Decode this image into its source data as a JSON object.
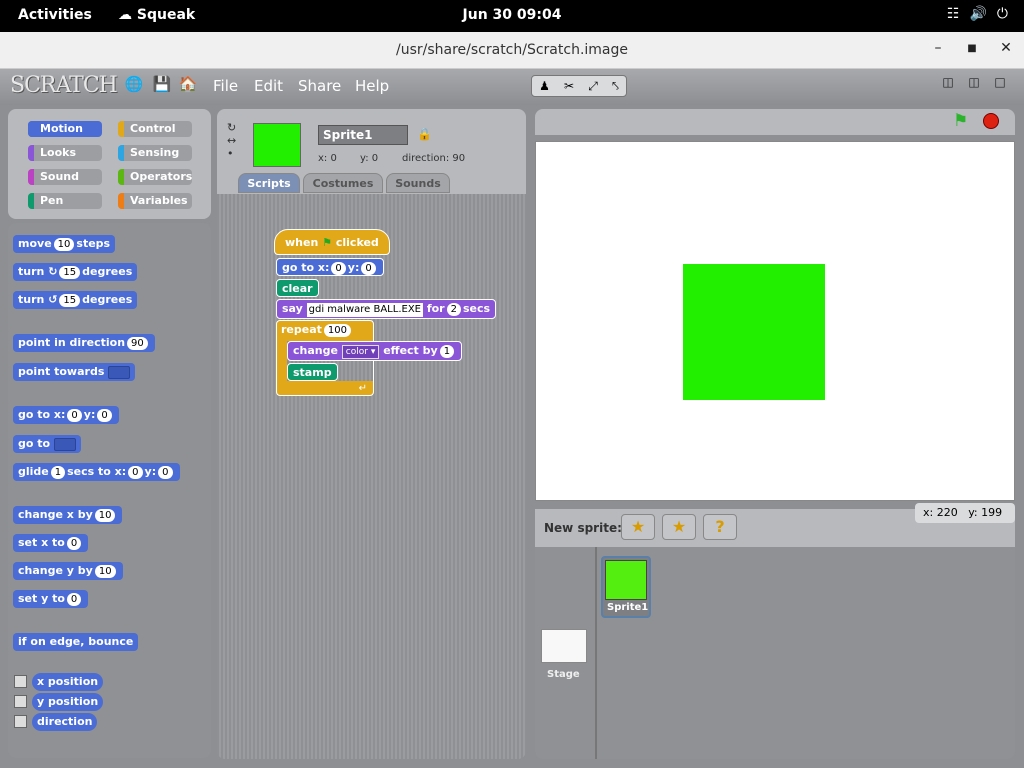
{
  "system": {
    "activities": "Activities",
    "app_name": "Squeak",
    "clock": "Jun 30  09:04"
  },
  "window": {
    "title": "/usr/share/scratch/Scratch.image"
  },
  "menu": {
    "logo": "SCRATCH",
    "file": "File",
    "edit": "Edit",
    "share": "Share",
    "help": "Help"
  },
  "categories": [
    "Motion",
    "Control",
    "Looks",
    "Sensing",
    "Sound",
    "Operators",
    "Pen",
    "Variables"
  ],
  "category_colors": {
    "motion": "#4a6cd4",
    "control": "#e1a91a",
    "looks": "#8a55d7",
    "sensing": "#2ca5e2",
    "sound": "#bb42c3",
    "operators": "#5cb712",
    "pen": "#0e9a6c",
    "variables": "#ee7d16"
  },
  "palette": {
    "move": "move",
    "move_val": "10",
    "move_unit": "steps",
    "turn": "turn",
    "turn_val": "15",
    "degrees": "degrees",
    "point_dir": "point in direction",
    "point_dir_val": "90",
    "point_towards": "point towards",
    "goto_xy": "go to x:",
    "goto_x": "0",
    "y_label": "y:",
    "goto_y": "0",
    "goto": "go to",
    "glide": "glide",
    "glide_secs": "1",
    "glide_mid": "secs to x:",
    "glide_x": "0",
    "glide_y": "0",
    "change_x": "change x by",
    "change_x_val": "10",
    "set_x": "set x to",
    "set_x_val": "0",
    "change_y": "change y by",
    "change_y_val": "10",
    "set_y": "set y to",
    "set_y_val": "0",
    "bounce": "if on edge, bounce",
    "x_position": "x position",
    "y_position": "y position",
    "direction": "direction"
  },
  "sprite": {
    "name": "Sprite1",
    "x_label": "x: 0",
    "y_label": "y: 0",
    "direction": "direction: 90"
  },
  "tabs": [
    "Scripts",
    "Costumes",
    "Sounds"
  ],
  "script": {
    "when": "when",
    "clicked": "clicked",
    "goto": "go to x:",
    "x": "0",
    "y_label": "y:",
    "y": "0",
    "clear": "clear",
    "say": "say",
    "say_text": "gdi malware BALL.EXE",
    "for": "for",
    "secs_val": "2",
    "secs": "secs",
    "repeat": "repeat",
    "repeat_val": "100",
    "change": "change",
    "effect_name": "color",
    "effect_by": "effect by",
    "effect_val": "1",
    "stamp": "stamp"
  },
  "stage": {
    "mouse_x": "x: 220",
    "mouse_y": "y: 199",
    "square_color": "#22ee00"
  },
  "sprites_pane": {
    "new_sprite": "New sprite:",
    "sprite_label": "Sprite1",
    "stage_label": "Stage"
  }
}
